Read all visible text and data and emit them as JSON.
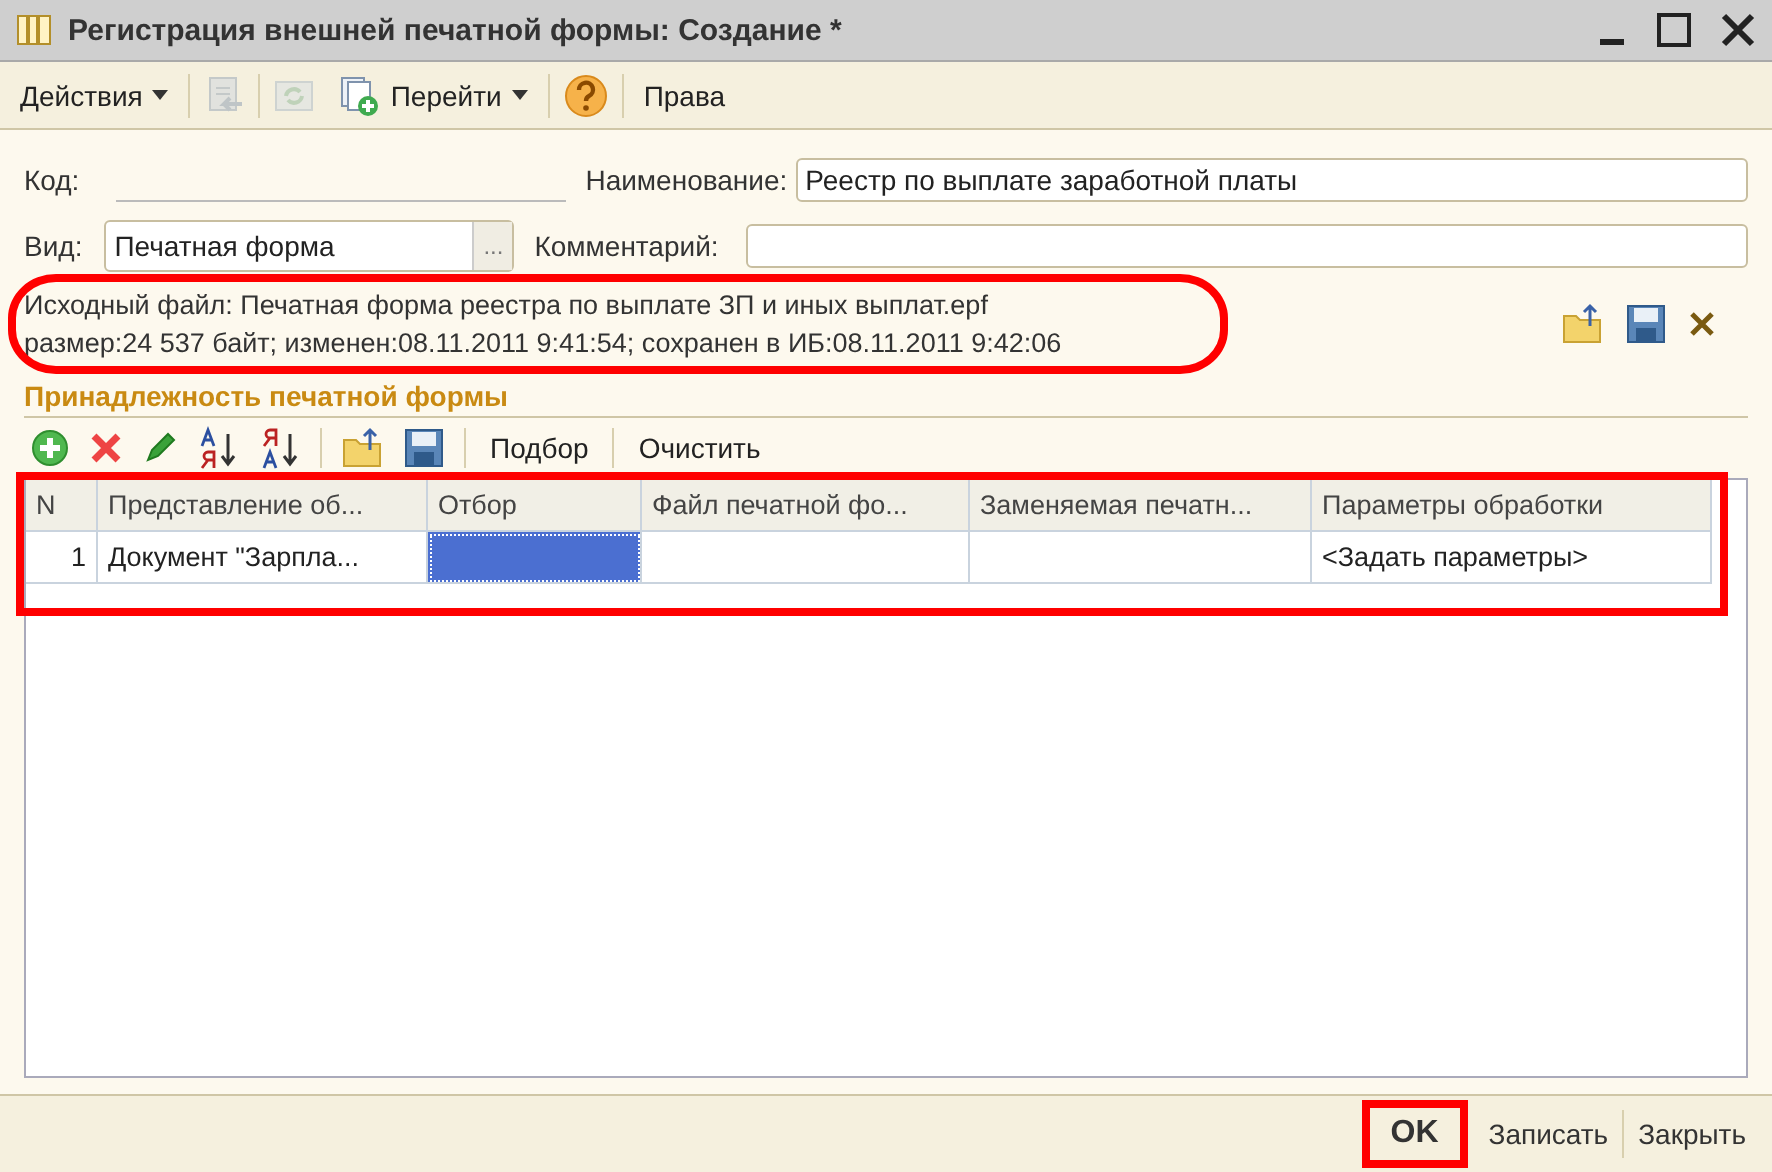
{
  "window": {
    "title": "Регистрация внешней печатной формы: Создание *"
  },
  "toolbar": {
    "items": [
      {
        "kind": "menu",
        "label": "Действия"
      },
      {
        "kind": "icon",
        "disabled": true
      },
      {
        "kind": "icon",
        "disabled": true
      },
      {
        "kind": "menu",
        "label": "Перейти"
      },
      {
        "kind": "icon",
        "disabled": false
      },
      {
        "kind": "button",
        "label": "Права"
      }
    ]
  },
  "form": {
    "code": {
      "label": "Код:"
    },
    "name": {
      "label": "Наименование:",
      "value": "Реестр по выплате заработной платы"
    },
    "kind": {
      "label": "Вид:",
      "value": "Печатная форма",
      "button": "..."
    },
    "comment": {
      "label": "Комментарий:"
    }
  },
  "file_info": [
    "Исходный файл: Печатная форма реестра по выплате ЗП и иных выплат.epf",
    "размер:24 537 байт; изменен:08.11.2011 9:41:54; сохранен в ИБ:08.11.2011 9:42:06"
  ],
  "section": {
    "title": "Принадлежность печатной формы"
  },
  "table_toolbar": {
    "buttons": [
      "Подбор",
      "Очистить"
    ]
  },
  "table": {
    "columns": [
      "N",
      "Представление об...",
      "Отбор",
      "Файл печатной фо...",
      "Заменяемая печатн...",
      "Параметры обработки"
    ],
    "rows": [
      {
        "cells": [
          {
            "text": "1",
            "selected": false
          },
          {
            "text": "Документ \"Зарпла...",
            "selected": false
          },
          {
            "selected": true
          },
          {
            "selected": false
          },
          {
            "selected": false
          },
          {
            "text": "<Задать параметры>",
            "selected": false
          }
        ]
      }
    ]
  },
  "footer": {
    "buttons": [
      {
        "label": "OK",
        "default": true
      },
      {
        "label": "Записать",
        "default": false
      },
      {
        "label": "Закрыть",
        "default": false
      }
    ]
  }
}
